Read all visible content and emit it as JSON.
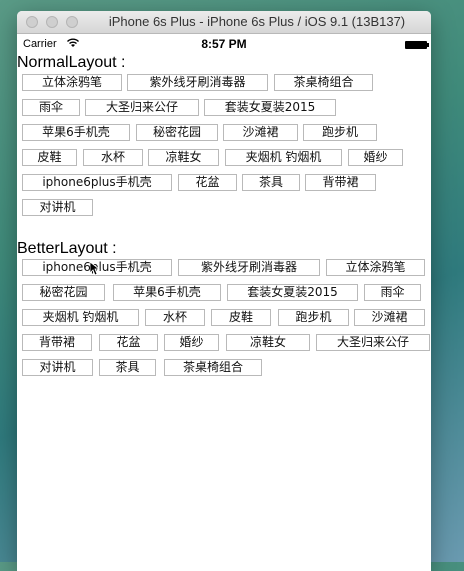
{
  "window": {
    "title": "iPhone 6s Plus - iPhone 6s Plus / iOS 9.1 (13B137)"
  },
  "status_bar": {
    "carrier": "Carrier",
    "time": "8:57 PM"
  },
  "normal_layout": {
    "title": "NormalLayout :",
    "tags": [
      "立体涂鸦笔",
      "紫外线牙刷消毒器",
      "茶桌椅组合",
      "雨伞",
      "大圣归来公仔",
      "套装女夏装2015",
      "苹果6手机壳",
      "秘密花园",
      "沙滩裙",
      "跑步机",
      "皮鞋",
      "水杯",
      "凉鞋女",
      "夹烟机 钓烟机",
      "婚纱",
      "iphone6plus手机壳",
      "花盆",
      "茶具",
      "背带裙",
      "对讲机"
    ]
  },
  "better_layout": {
    "title": "BetterLayout :",
    "tags": [
      "iphone6plus手机壳",
      "紫外线牙刷消毒器",
      "立体涂鸦笔",
      "秘密花园",
      "苹果6手机壳",
      "套装女夏装2015",
      "雨伞",
      "夹烟机 钓烟机",
      "水杯",
      "皮鞋",
      "跑步机",
      "沙滩裙",
      "背带裙",
      "花盆",
      "婚纱",
      "凉鞋女",
      "大圣归来公仔",
      "对讲机",
      "茶具",
      "茶桌椅组合"
    ]
  }
}
